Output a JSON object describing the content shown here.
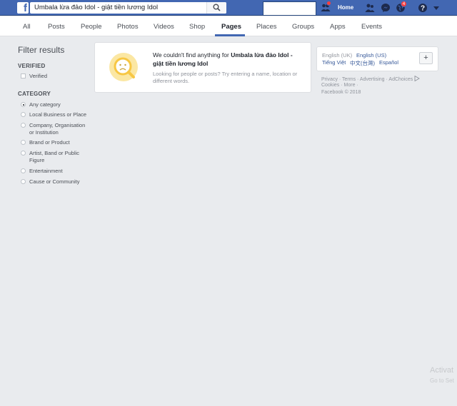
{
  "header": {
    "logo": "f",
    "search_query": "Umbala lừa đảo Idol - giật tiền lương Idol",
    "home_label": "Home",
    "notification_count": "4"
  },
  "tabs": [
    {
      "label": "All"
    },
    {
      "label": "Posts"
    },
    {
      "label": "People"
    },
    {
      "label": "Photos"
    },
    {
      "label": "Videos"
    },
    {
      "label": "Shop"
    },
    {
      "label": "Pages",
      "active": true
    },
    {
      "label": "Places"
    },
    {
      "label": "Groups"
    },
    {
      "label": "Apps"
    },
    {
      "label": "Events"
    }
  ],
  "filter": {
    "title": "Filter results",
    "verified_heading": "VERIFIED",
    "verified_option": "Verified",
    "category_heading": "CATEGORY",
    "categories": [
      {
        "label": "Any category",
        "selected": true
      },
      {
        "label": "Local Business or Place"
      },
      {
        "label": "Company, Organisation or Institution"
      },
      {
        "label": "Brand or Product"
      },
      {
        "label": "Artist, Band or Public Figure"
      },
      {
        "label": "Entertainment"
      },
      {
        "label": "Cause or Community"
      }
    ]
  },
  "result": {
    "prefix": "We couldn't find anything for",
    "query": "Umbala lừa đảo Idol - giật tiền lương Idol",
    "hint": "Looking for people or posts? Try entering a name, location or different words."
  },
  "languages": {
    "current": "English (UK)",
    "options": [
      "English (US)",
      "Tiếng Việt",
      "中文(台灣)",
      "Español"
    ],
    "add_label": "+"
  },
  "footer": {
    "line1": "Privacy · Terms · Advertising · AdChoices",
    "line2": "Cookies · More ·",
    "line3": "Facebook © 2018"
  },
  "watermark": {
    "line1": "Activat",
    "line2": "Go to Set"
  },
  "colors": {
    "brand_blue": "#4267b2",
    "page_bg": "#e9ebee",
    "link": "#365899",
    "badge_red": "#fa3e3e",
    "empty_icon_yellow": "#f7d46b"
  }
}
